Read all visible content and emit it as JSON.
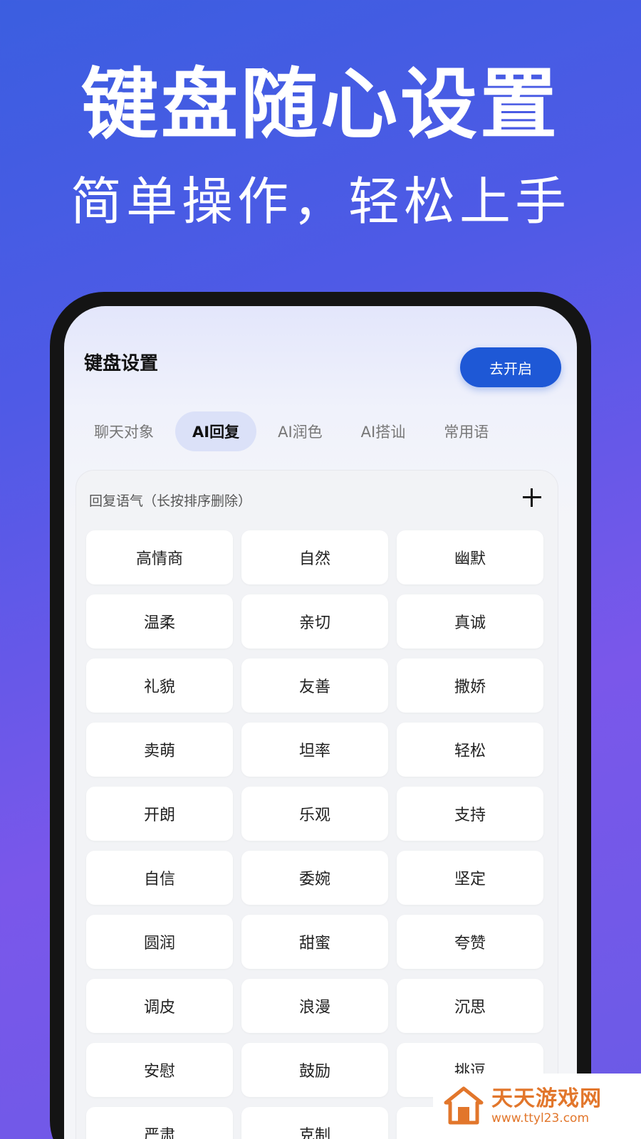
{
  "hero": {
    "title": "键盘随心设置",
    "subtitle": "简单操作，轻松上手"
  },
  "header": {
    "title": "键盘设置",
    "open_button": "去开启"
  },
  "tabs": [
    {
      "label": "聊天对象",
      "active": false
    },
    {
      "label": "AI回复",
      "active": true
    },
    {
      "label": "AI润色",
      "active": false
    },
    {
      "label": "AI搭讪",
      "active": false
    },
    {
      "label": "常用语",
      "active": false
    }
  ],
  "panel": {
    "label": "回复语气（长按排序删除）",
    "add_icon": "plus-icon"
  },
  "tones": [
    "高情商",
    "自然",
    "幽默",
    "温柔",
    "亲切",
    "真诚",
    "礼貌",
    "友善",
    "撒娇",
    "卖萌",
    "坦率",
    "轻松",
    "开朗",
    "乐观",
    "支持",
    "自信",
    "委婉",
    "坚定",
    "圆润",
    "甜蜜",
    "夸赞",
    "调皮",
    "浪漫",
    "沉思",
    "安慰",
    "鼓励",
    "挑逗",
    "严肃",
    "克制",
    ""
  ],
  "watermark": {
    "name": "天天游戏网",
    "url": "www.ttyl23.com"
  },
  "colors": {
    "accent": "#1e58d6",
    "background_top": "#3b5ee0",
    "background_bottom": "#7a57ea",
    "watermark": "#e2762b"
  }
}
